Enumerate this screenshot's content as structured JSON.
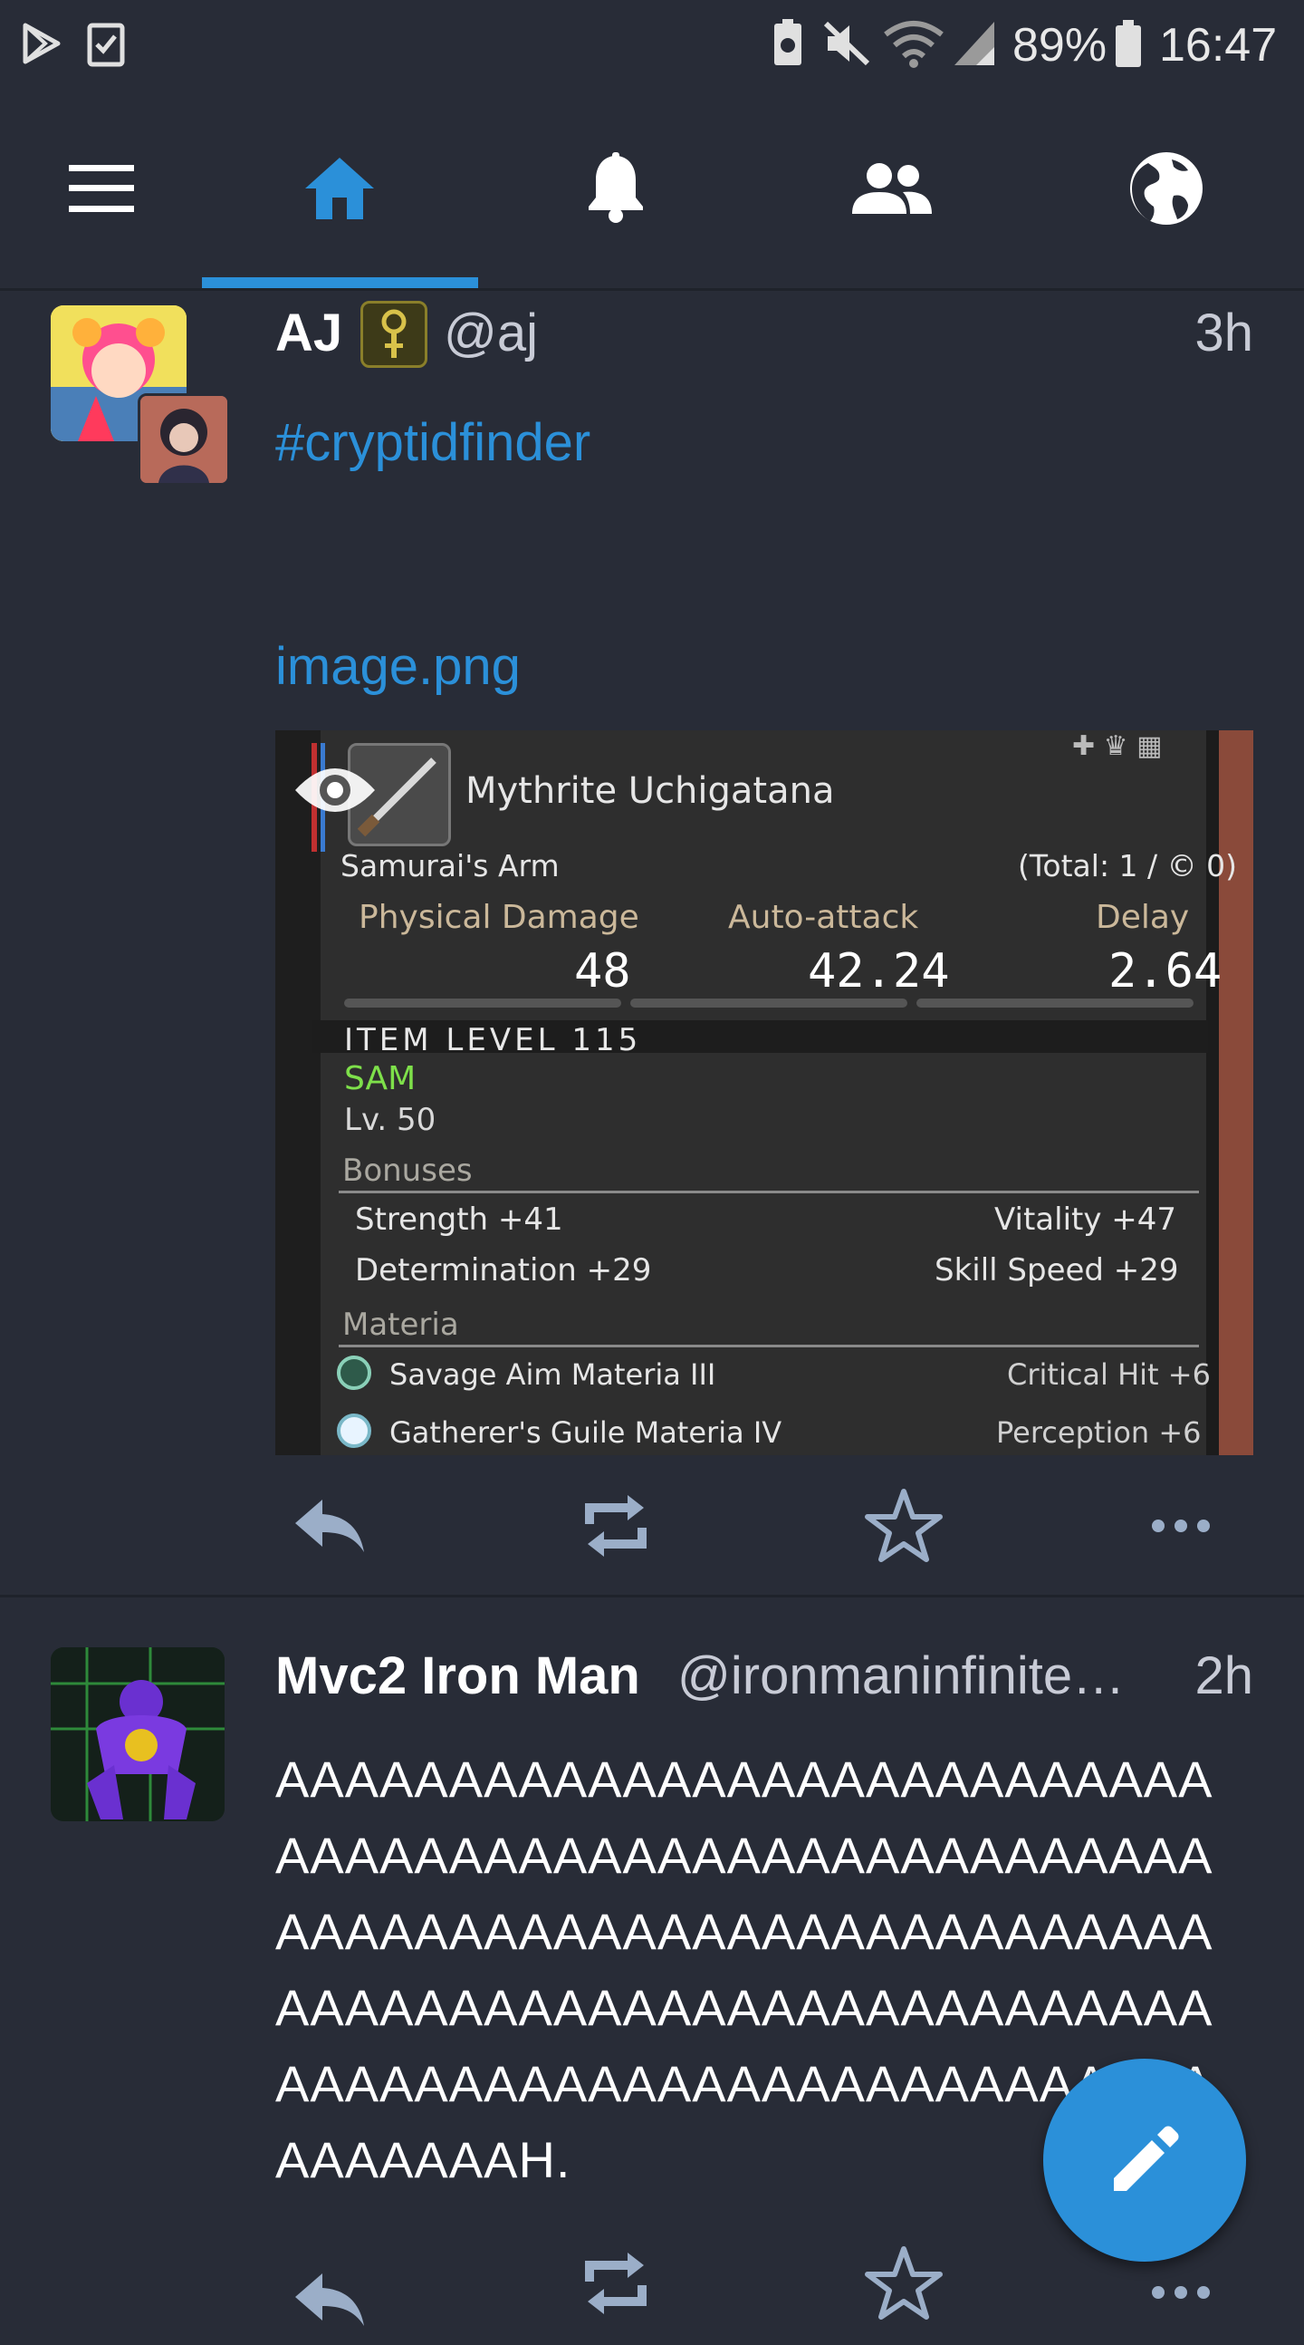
{
  "status_bar": {
    "battery": "89%",
    "time": "16:47"
  },
  "nav": {
    "tabs": [
      "menu",
      "home",
      "notifications",
      "local",
      "federated"
    ],
    "active": "home"
  },
  "posts": [
    {
      "display_name": "AJ",
      "handle": "@aj",
      "time": "3h",
      "hashtag": "#cryptidfinder",
      "attachment_link": "image.png",
      "attachment": {
        "item_name": "Mythrite Uchigatana",
        "category": "Samurai's Arm",
        "total": "(Total: 1 / © 0)",
        "stat_headers": [
          "Physical Damage",
          "Auto-attack",
          "Delay"
        ],
        "stat_values": [
          "48",
          "42.24",
          "2.64"
        ],
        "item_level": "ITEM LEVEL 115",
        "job": "SAM",
        "level": "Lv. 50",
        "bonuses_label": "Bonuses",
        "bonuses": [
          {
            "left": "Strength +41",
            "right": "Vitality +47"
          },
          {
            "left": "Determination +29",
            "right": "Skill Speed +29"
          }
        ],
        "materia_label": "Materia",
        "materia": [
          {
            "name": "Savage Aim Materia III",
            "effect": "Critical Hit +6"
          },
          {
            "name": "Gatherer's Guile Materia IV",
            "effect": "Perception +6"
          }
        ]
      }
    },
    {
      "display_name": "Mvc2 Iron Man",
      "handle": "@ironmaninfinite…",
      "time": "2h",
      "text": "AAAAAAAAAAAAAAAAAAAAAAAAAAAAAAAAAAAAAAAAAAAAAAAAAAAAAAAAAAAAAAAAAAAAAAAAAAAAAAAAAAAAAAAAAAAAAAAAAAAAAAAAAAAAAAAAAAAAAAAAAAAAAAAAAAAAAAAAAAAAAAH."
    }
  ],
  "colors": {
    "background": "#282c37",
    "accent": "#2b90d9",
    "icon": "#9baec8"
  }
}
